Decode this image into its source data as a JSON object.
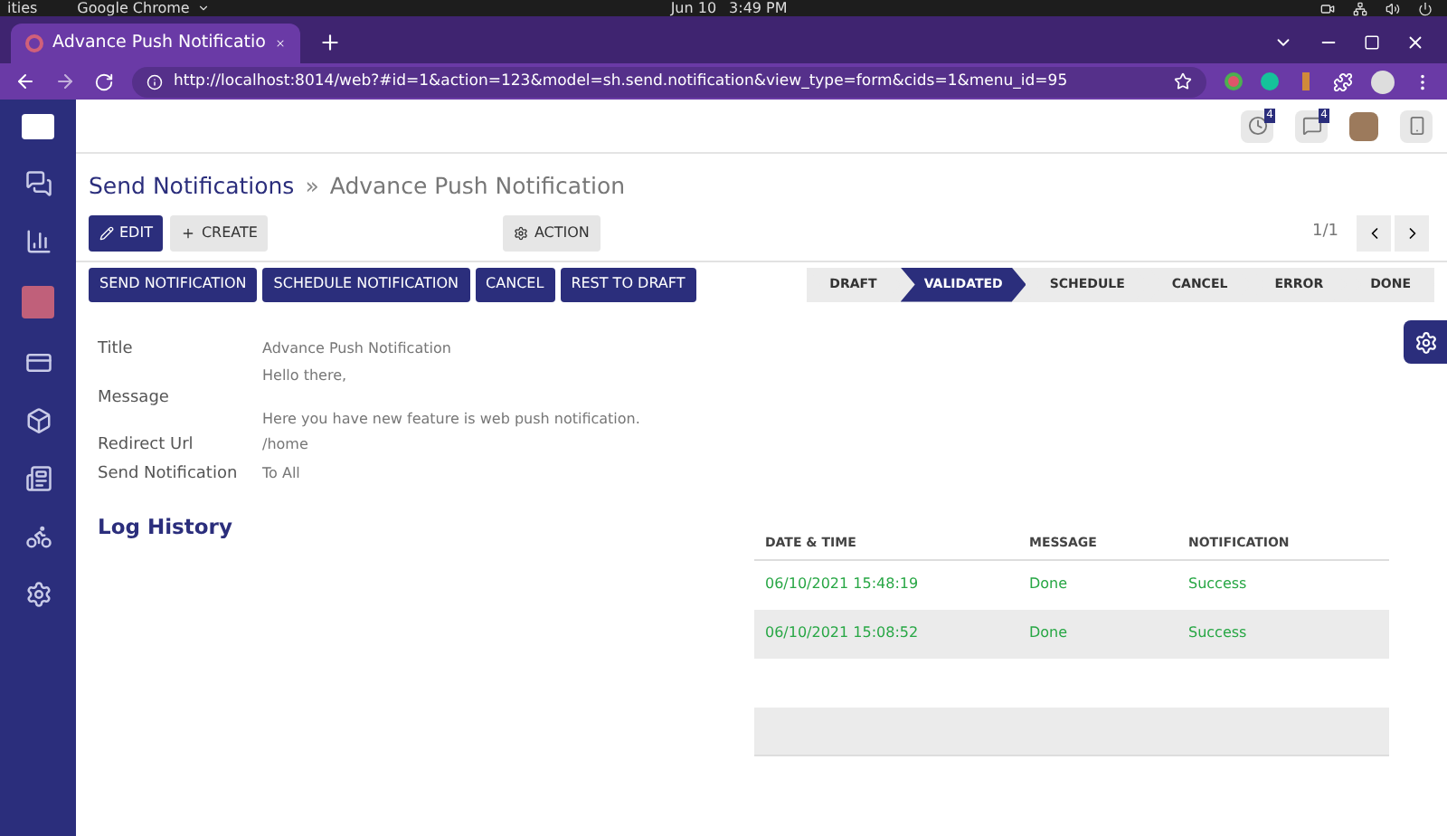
{
  "os_bar": {
    "activities": "ities",
    "app": "Google Chrome",
    "date": "Jun 10",
    "time": "3:49 PM"
  },
  "browser": {
    "tab_title": "Advance Push Notificatio",
    "url": "http://localhost:8014/web?#id=1&action=123&model=sh.send.notification&view_type=form&cids=1&menu_id=95"
  },
  "header": {
    "activity_count": "4",
    "message_count": "4"
  },
  "breadcrumb": {
    "parent": "Send Notifications",
    "separator": "»",
    "current": "Advance Push Notification"
  },
  "toolbar": {
    "edit": "EDIT",
    "create": "CREATE",
    "action": "ACTION",
    "pager": "1/1"
  },
  "action_buttons": [
    "SEND NOTIFICATION",
    "SCHEDULE NOTIFICATION",
    "CANCEL",
    "REST TO DRAFT"
  ],
  "statusbar": [
    {
      "label": "DRAFT",
      "selected": false
    },
    {
      "label": "VALIDATED",
      "selected": true
    },
    {
      "label": "SCHEDULE",
      "selected": false
    },
    {
      "label": "CANCEL",
      "selected": false
    },
    {
      "label": "ERROR",
      "selected": false
    },
    {
      "label": "DONE",
      "selected": false
    }
  ],
  "fields": [
    {
      "label": "Title",
      "value": [
        "Advance Push Notification"
      ]
    },
    {
      "label": "Message",
      "value": [
        "Hello there,",
        "Here you have new feature is web push notification."
      ]
    },
    {
      "label": "Redirect Url",
      "value": [
        "/home"
      ]
    },
    {
      "label": "Send Notification",
      "value": [
        "To All"
      ]
    }
  ],
  "log_history": {
    "title": "Log History",
    "columns": [
      "DATE & TIME",
      "MESSAGE",
      "NOTIFICATION"
    ],
    "rows": [
      [
        "06/10/2021 15:48:19",
        "Done",
        "Success"
      ],
      [
        "06/10/2021 15:08:52",
        "Done",
        "Success"
      ]
    ]
  }
}
